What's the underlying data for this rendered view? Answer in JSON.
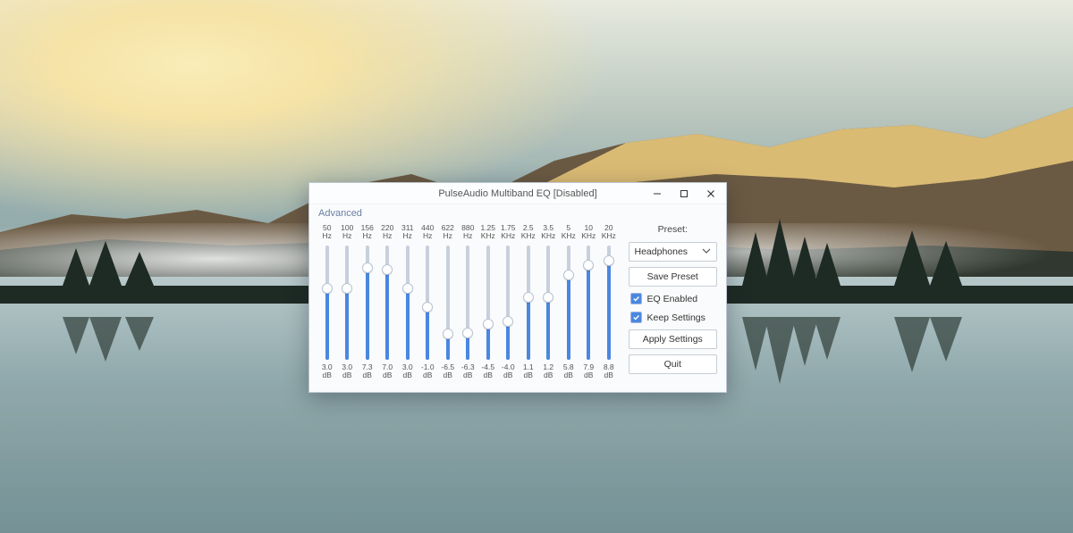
{
  "slider_range_db": 12,
  "window": {
    "title": "PulseAudio Multiband EQ [Disabled]"
  },
  "menu": {
    "advanced": "Advanced"
  },
  "bands": [
    {
      "freq": "50",
      "freq_unit": "Hz",
      "value": "3.0",
      "value_unit": "dB",
      "num": 3.0
    },
    {
      "freq": "100",
      "freq_unit": "Hz",
      "value": "3.0",
      "value_unit": "dB",
      "num": 3.0
    },
    {
      "freq": "156",
      "freq_unit": "Hz",
      "value": "7.3",
      "value_unit": "dB",
      "num": 7.3
    },
    {
      "freq": "220",
      "freq_unit": "Hz",
      "value": "7.0",
      "value_unit": "dB",
      "num": 7.0
    },
    {
      "freq": "311",
      "freq_unit": "Hz",
      "value": "3.0",
      "value_unit": "dB",
      "num": 3.0
    },
    {
      "freq": "440",
      "freq_unit": "Hz",
      "value": "-1.0",
      "value_unit": "dB",
      "num": -1.0
    },
    {
      "freq": "622",
      "freq_unit": "Hz",
      "value": "-6.5",
      "value_unit": "dB",
      "num": -6.5
    },
    {
      "freq": "880",
      "freq_unit": "Hz",
      "value": "-6.3",
      "value_unit": "dB",
      "num": -6.3
    },
    {
      "freq": "1.25",
      "freq_unit": "KHz",
      "value": "-4.5",
      "value_unit": "dB",
      "num": -4.5
    },
    {
      "freq": "1.75",
      "freq_unit": "KHz",
      "value": "-4.0",
      "value_unit": "dB",
      "num": -4.0
    },
    {
      "freq": "2.5",
      "freq_unit": "KHz",
      "value": "1.1",
      "value_unit": "dB",
      "num": 1.1
    },
    {
      "freq": "3.5",
      "freq_unit": "KHz",
      "value": "1.2",
      "value_unit": "dB",
      "num": 1.2
    },
    {
      "freq": "5",
      "freq_unit": "KHz",
      "value": "5.8",
      "value_unit": "dB",
      "num": 5.8
    },
    {
      "freq": "10",
      "freq_unit": "KHz",
      "value": "7.9",
      "value_unit": "dB",
      "num": 7.9
    },
    {
      "freq": "20",
      "freq_unit": "KHz",
      "value": "8.8",
      "value_unit": "dB",
      "num": 8.8
    }
  ],
  "side": {
    "preset_label": "Preset:",
    "preset_value": "Headphones",
    "save_preset": "Save Preset",
    "eq_enabled_label": "EQ Enabled",
    "eq_enabled": true,
    "keep_settings_label": "Keep Settings",
    "keep_settings": true,
    "apply": "Apply Settings",
    "quit": "Quit"
  }
}
